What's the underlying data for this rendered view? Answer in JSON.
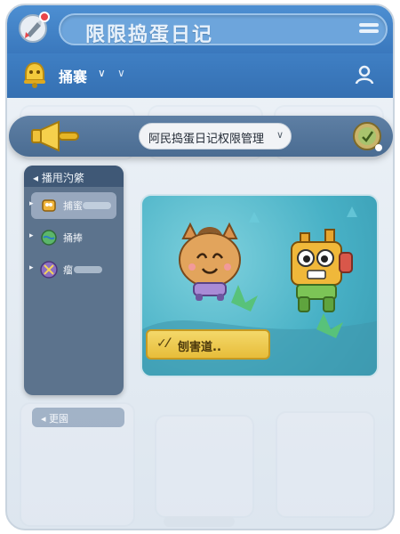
{
  "app": {
    "title": "限限捣蛋日记",
    "icons": {
      "app": "rocket-icon",
      "menu": "menu-icon"
    }
  },
  "subbar": {
    "label": "捅褰",
    "caret": "∨",
    "caret2": "∨",
    "icons": {
      "left": "bell-icon",
      "right": "user-icon"
    }
  },
  "announcement": {
    "text": "阿民捣蛋日记权限管理",
    "caret": "∨",
    "icons": {
      "left": "horn-icon",
      "right": "medal-icon"
    }
  },
  "menu_panel": {
    "header": "◂ 播甩汋綮",
    "items": [
      {
        "label": "捕蜜",
        "icon": "robot-icon",
        "active": true
      },
      {
        "label": "捅捧",
        "icon": "globe-icon",
        "active": false
      },
      {
        "label": "瘤",
        "icon": "crossed-swords-icon",
        "active": false
      }
    ]
  },
  "hero": {
    "banner_label": "刨害道..",
    "banner_check": "✓⁄"
  },
  "section2": {
    "header": "◂ 更園"
  },
  "colors": {
    "titlebar": "#4d8fd2",
    "subbar": "#3f7fc4",
    "overlay": "#5e7fa4",
    "banner": "#f4d86a"
  }
}
